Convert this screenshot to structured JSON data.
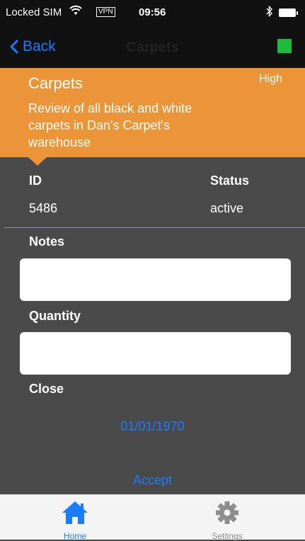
{
  "status_bar": {
    "carrier": "Locked SIM",
    "vpn": "VPN",
    "time": "09:56",
    "wifi_icon": "wifi-icon",
    "bluetooth_icon": "bluetooth-icon",
    "battery_icon": "battery-icon"
  },
  "nav": {
    "back_label": "Back",
    "title": "Carpets",
    "status_color": "#1ebc3c"
  },
  "task": {
    "title": "Carpets",
    "priority": "High",
    "description": "Review of all black and white carpets in Dan's Carpet's warehouse",
    "color": "#ec9438"
  },
  "details": {
    "id_label": "ID",
    "id_value": "5486",
    "status_label": "Status",
    "status_value": "active"
  },
  "form": {
    "notes_label": "Notes",
    "notes_value": "",
    "quantity_label": "Quantity",
    "quantity_value": "",
    "close_label": "Close",
    "close_date": "01/01/1970",
    "accept_label": "Accept"
  },
  "tabs": [
    {
      "label": "Home",
      "icon": "home-icon",
      "active": true,
      "color": "#1a7cff"
    },
    {
      "label": "Settings",
      "icon": "gear-icon",
      "active": false,
      "color": "#8e8e8e"
    }
  ]
}
